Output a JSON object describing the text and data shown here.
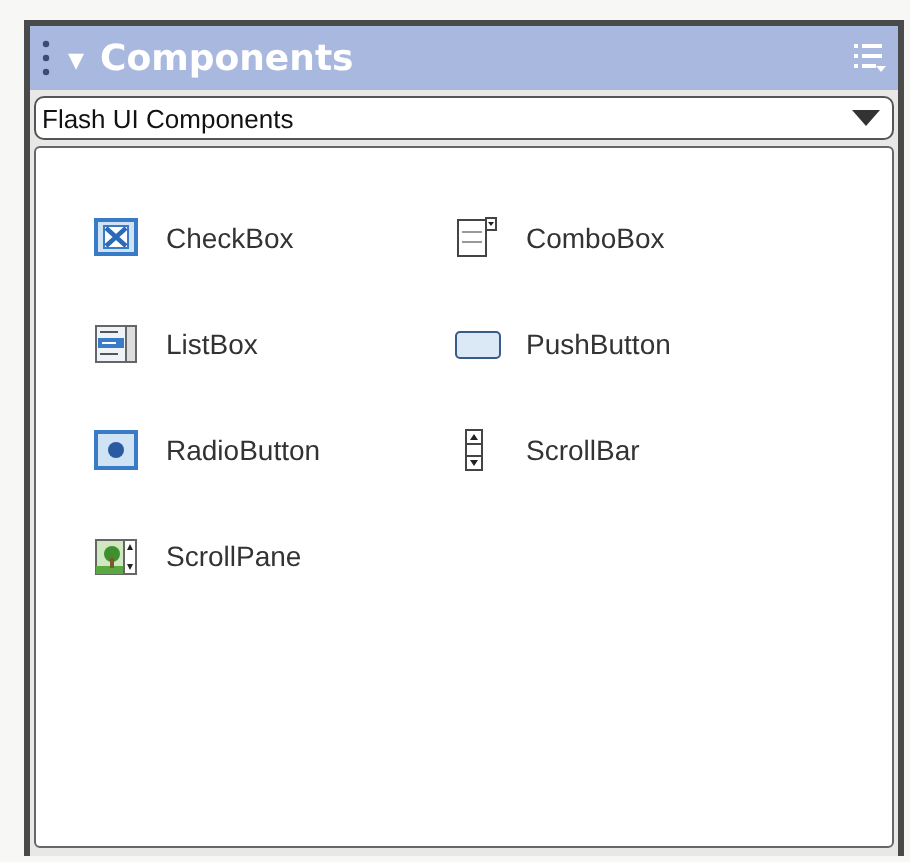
{
  "panel": {
    "title": "Components",
    "collapse_glyph": "▾"
  },
  "library_select": {
    "value": "Flash UI Components"
  },
  "components": [
    {
      "kind": "checkbox",
      "label": "CheckBox"
    },
    {
      "kind": "combobox",
      "label": "ComboBox"
    },
    {
      "kind": "listbox",
      "label": "ListBox"
    },
    {
      "kind": "pushbutton",
      "label": "PushButton"
    },
    {
      "kind": "radiobutton",
      "label": "RadioButton"
    },
    {
      "kind": "scrollbar",
      "label": "ScrollBar"
    },
    {
      "kind": "scrollpane",
      "label": "ScrollPane"
    }
  ]
}
